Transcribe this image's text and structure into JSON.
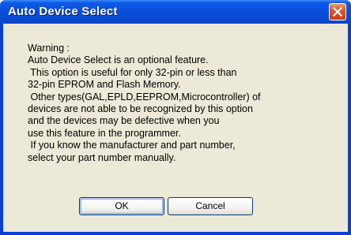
{
  "dialog": {
    "title": "Auto Device Select",
    "message_lines": [
      "Warning :",
      "Auto Device Select is an optional feature.",
      " This option is useful for only 32-pin or less than",
      "32-pin EPROM and Flash Memory.",
      " Other types(GAL,EPLD,EEPROM,Microcontroller) of",
      "devices are not able to be recognized by this option",
      "and the devices may be defective when you",
      "use this feature in the programmer.",
      " If you know the manufacturer and part number,",
      "select your part number manually."
    ],
    "buttons": {
      "ok_label": "OK",
      "cancel_label": "Cancel"
    },
    "close_icon": "close-icon",
    "colors": {
      "titlebar": "#0a4fdc",
      "close_button": "#d9562c",
      "client": "#ece9d8"
    }
  }
}
